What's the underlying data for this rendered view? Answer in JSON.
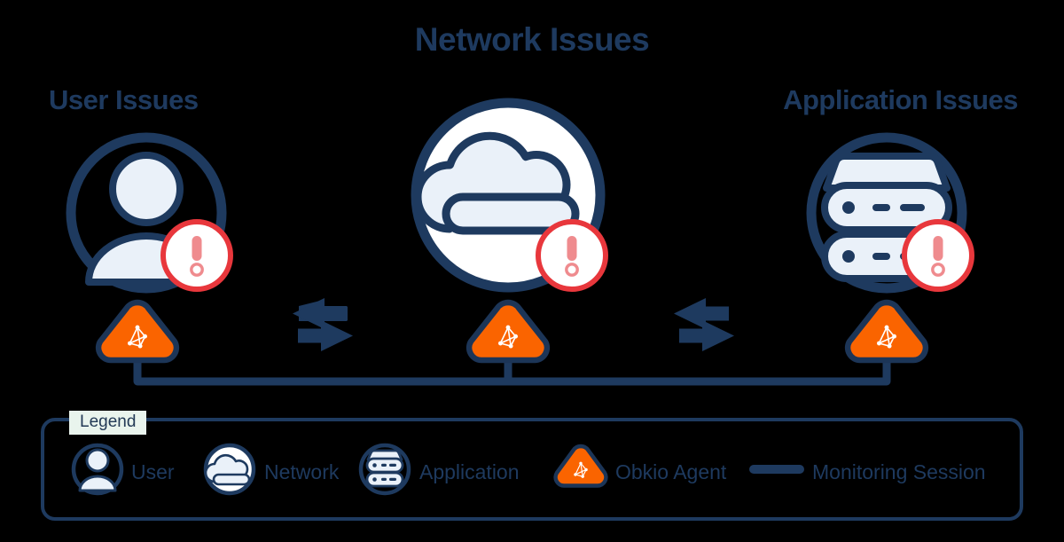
{
  "diagram": {
    "title_center": "Network Issues",
    "title_left": "User Issues",
    "title_right": "Application Issues",
    "background_color": "#000000",
    "colors": {
      "navy": "#1e3a5f",
      "navy_dark": "#1c3557",
      "orange": "#fa6400",
      "alert_red": "#e8373c",
      "alert_red_light": "#ef8b8e",
      "icon_fill": "#eaf1f9",
      "white": "#ffffff",
      "legend_chip_bg": "#e9f4ed"
    }
  },
  "nodes": [
    {
      "id": "user",
      "label": "User Issues",
      "icon": "user-icon",
      "has_alert_badge": true,
      "agent": "obkio-agent-icon"
    },
    {
      "id": "network",
      "label": "Network Issues",
      "icon": "cloud-icon",
      "has_alert_badge": true,
      "agent": "obkio-agent-icon"
    },
    {
      "id": "application",
      "label": "Application Issues",
      "icon": "server-icon",
      "has_alert_badge": true,
      "agent": "obkio-agent-icon"
    }
  ],
  "connectors": [
    {
      "id": "user-to-network",
      "icon": "bidirectional-arrows-icon"
    },
    {
      "id": "network-to-application",
      "icon": "bidirectional-arrows-icon"
    }
  ],
  "legend": {
    "title": "Legend",
    "items": [
      {
        "icon": "user-icon",
        "label": "User"
      },
      {
        "icon": "cloud-icon",
        "label": "Network"
      },
      {
        "icon": "server-icon",
        "label": "Application"
      },
      {
        "icon": "obkio-agent-icon",
        "label": "Obkio Agent"
      },
      {
        "icon": "line-icon",
        "label": "Monitoring Session"
      }
    ]
  }
}
